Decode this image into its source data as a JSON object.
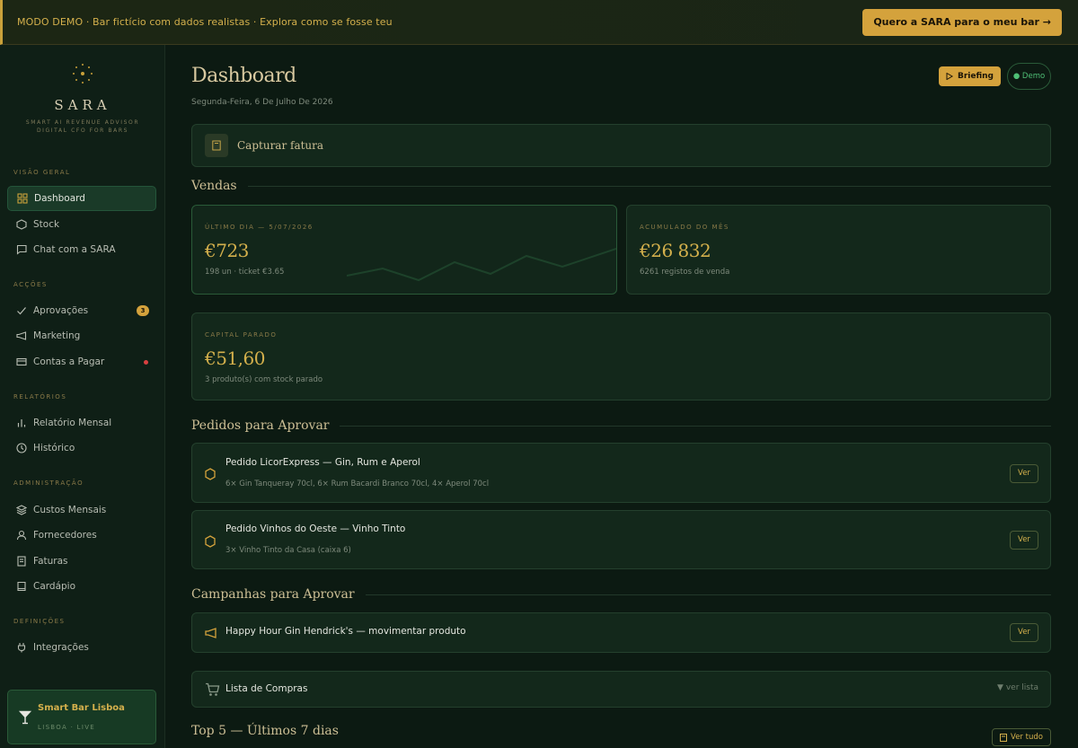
{
  "banner": {
    "text": "MODO DEMO · Bar fictício com dados realistas · Explora como se fosse teu",
    "cta": "Quero a SARA para o meu bar →"
  },
  "brand": {
    "name": "SARA",
    "tagline_1": "SMART AI REVENUE ADVISOR",
    "tagline_2": "DIGITAL CFO FOR BARS"
  },
  "sidebar": {
    "sections": {
      "overview": "VISÃO GERAL",
      "actions": "ACÇÕES",
      "reports": "RELATÓRIOS",
      "admin": "ADMINISTRAÇÃO",
      "settings": "DEFINIÇÕES"
    },
    "items": {
      "dashboard": "Dashboard",
      "stock": "Stock",
      "chat": "Chat com a SARA",
      "approvals": "Aprovações",
      "approvals_badge": "3",
      "marketing": "Marketing",
      "payables": "Contas a Pagar",
      "monthly_report": "Relatório Mensal",
      "history": "Histórico",
      "monthly_costs": "Custos Mensais",
      "suppliers": "Fornecedores",
      "invoices": "Faturas",
      "menu": "Cardápio",
      "integrations": "Integrações"
    },
    "bar": {
      "name": "Smart Bar Lisboa",
      "status": "LISBOA · LIVE"
    }
  },
  "header": {
    "title": "Dashboard",
    "date": "Segunda-Feira, 6 De Julho De 2026",
    "briefing": "Briefing",
    "demo": "● Demo"
  },
  "capture": {
    "label": "Capturar fatura"
  },
  "sales": {
    "title": "Vendas",
    "last_day": {
      "label": "ÚLTIMO DIA — 5/07/2026",
      "value": "€723",
      "sub": "198 un · ticket €3.65"
    },
    "month": {
      "label": "ACUMULADO DO MÊS",
      "value": "€26 832",
      "sub": "6261 registos de venda"
    }
  },
  "capital": {
    "label": "CAPITAL PARADO",
    "value": "€51,60",
    "sub": "3 produto(s) com stock parado"
  },
  "orders": {
    "title": "Pedidos para Aprovar",
    "items": [
      {
        "title": "Pedido LicorExpress — Gin, Rum e Aperol",
        "desc": "6× Gin Tanqueray 70cl, 6× Rum Bacardi Branco 70cl, 4× Aperol 70cl",
        "action": "Ver"
      },
      {
        "title": "Pedido Vinhos do Oeste — Vinho Tinto",
        "desc": "3× Vinho Tinto da Casa (caixa 6)",
        "action": "Ver"
      }
    ]
  },
  "campaigns": {
    "title": "Campanhas para Aprovar",
    "items": [
      {
        "title": "Happy Hour Gin Hendrick's — movimentar produto",
        "action": "Ver"
      }
    ]
  },
  "shopping": {
    "label": "Lista de Compras",
    "toggle": "▼ ver lista"
  },
  "top5": {
    "title": "Top 5 — Últimos 7 dias",
    "action": "Ver tudo"
  },
  "colors": {
    "accent": "#d4a23c",
    "background": "#0c1a12",
    "live": "#4fbf76",
    "alert": "#d94040"
  }
}
